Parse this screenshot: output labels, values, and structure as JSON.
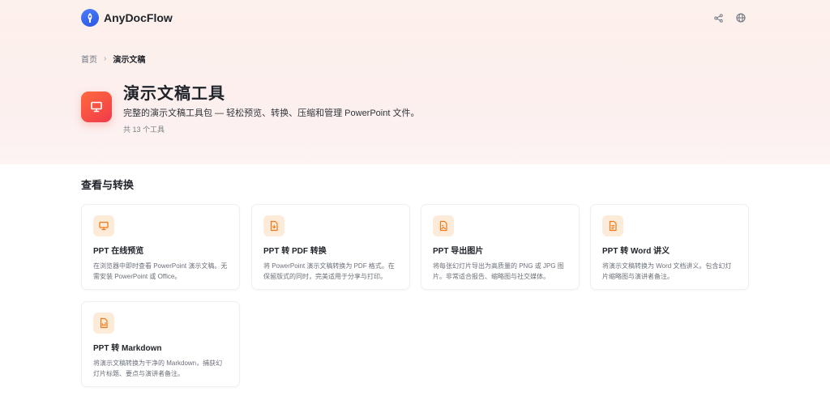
{
  "header": {
    "brand_name": "AnyDocFlow",
    "icons": [
      "share-icon",
      "globe-icon"
    ]
  },
  "breadcrumb": {
    "home": "首页",
    "separator": "›",
    "current": "演示文稿"
  },
  "page": {
    "title": "演示文稿工具",
    "description": "完整的演示文稿工具包 — 轻松预览、转换、压缩和管理 PowerPoint 文件。",
    "count": "共 13 个工具",
    "icon": "presentation-icon"
  },
  "section": {
    "title": "查看与转换"
  },
  "colors": {
    "accent": "#f04a3c",
    "icon_orange": "#f07a1a",
    "card_icon_bg": "#fdebd9"
  },
  "cards": [
    {
      "title": "PPT 在线预览",
      "description": "在浏览器中即时查看 PowerPoint 演示文稿。无需安装 PowerPoint 或 Office。",
      "icon": "presentation-icon"
    },
    {
      "title": "PPT 转 PDF 转换",
      "description": "将 PowerPoint 演示文稿转换为 PDF 格式。在保留版式的同时，完美适用于分享与打印。",
      "icon": "pdf-file-icon"
    },
    {
      "title": "PPT 导出图片",
      "description": "将每张幻灯片导出为高质量的 PNG 或 JPG 图片。非常适合报告、缩略图与社交媒体。",
      "icon": "image-file-icon"
    },
    {
      "title": "PPT 转 Word 讲义",
      "description": "将演示文稿转换为 Word 文档讲义。包含幻灯片缩略图与演讲者备注。",
      "icon": "document-icon"
    },
    {
      "title": "PPT 转 Markdown",
      "description": "将演示文稿转换为干净的 Markdown，捕获幻灯片标题、要点与演讲者备注。",
      "icon": "markdown-file-icon"
    }
  ]
}
